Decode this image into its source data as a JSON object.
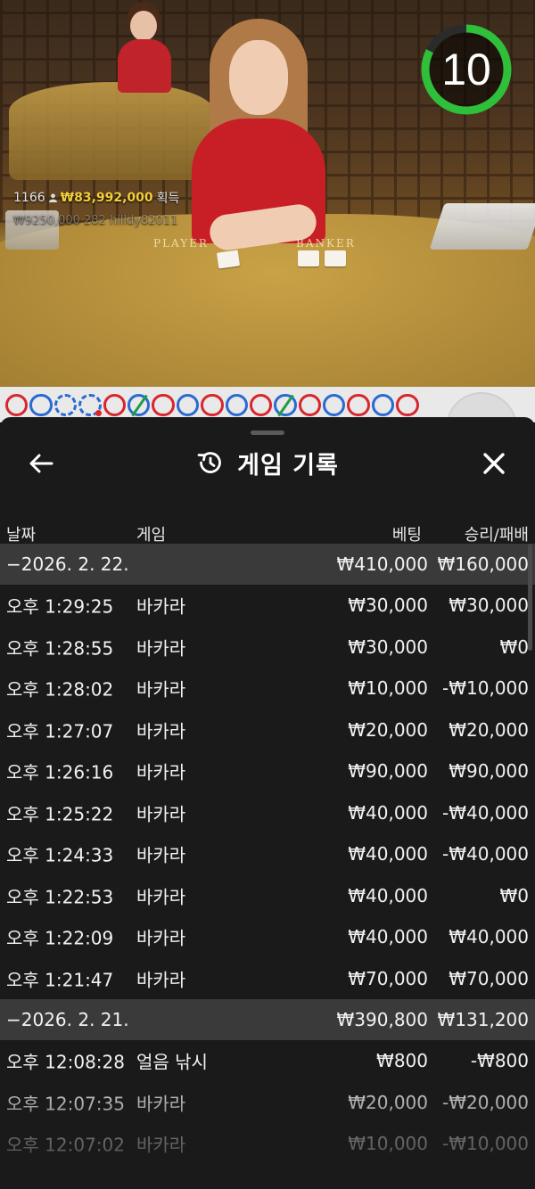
{
  "video": {
    "round_count": "1166",
    "win_amount": "₩83,992,000",
    "win_label": "획득",
    "ticker_text": "₩9250,000 282 hilldy82011",
    "table_player": "PLAYER",
    "table_banker": "BANKER",
    "countdown": "10"
  },
  "road": {
    "cells": [
      {
        "color": "red"
      },
      {
        "color": "blue"
      },
      {
        "color": "blue",
        "style": "dash"
      },
      {
        "color": "blue",
        "style": "dash",
        "dot": "red"
      },
      {
        "color": "red"
      },
      {
        "color": "blue",
        "slash": true
      },
      {
        "color": "red"
      },
      {
        "color": "blue"
      },
      {
        "color": "red"
      },
      {
        "color": "blue"
      },
      {
        "color": "red"
      },
      {
        "color": "blue",
        "slash": true
      },
      {
        "color": "red"
      },
      {
        "color": "blue"
      },
      {
        "color": "red"
      },
      {
        "color": "blue"
      },
      {
        "color": "red"
      }
    ],
    "colors": {
      "red": "#d8262e",
      "blue": "#2a6ad3",
      "tie": "#1f9c44"
    }
  },
  "panel": {
    "title": "게임 기록",
    "back_icon": "arrow-left-icon",
    "history_icon": "history-clock-icon",
    "close_icon": "close-icon",
    "columns": {
      "date": "날짜",
      "game": "게임",
      "bet": "베팅",
      "result": "승리/패배"
    },
    "groups": [
      {
        "date": "−2026. 2. 22.",
        "total_bet": "₩410,000",
        "total_result": "₩160,000",
        "rows": [
          {
            "time": "오후 1:29:25",
            "game": "바카라",
            "bet": "₩30,000",
            "result": "₩30,000"
          },
          {
            "time": "오후 1:28:55",
            "game": "바카라",
            "bet": "₩30,000",
            "result": "₩0"
          },
          {
            "time": "오후 1:28:02",
            "game": "바카라",
            "bet": "₩10,000",
            "result": "-₩10,000"
          },
          {
            "time": "오후 1:27:07",
            "game": "바카라",
            "bet": "₩20,000",
            "result": "₩20,000"
          },
          {
            "time": "오후 1:26:16",
            "game": "바카라",
            "bet": "₩90,000",
            "result": "₩90,000"
          },
          {
            "time": "오후 1:25:22",
            "game": "바카라",
            "bet": "₩40,000",
            "result": "-₩40,000"
          },
          {
            "time": "오후 1:24:33",
            "game": "바카라",
            "bet": "₩40,000",
            "result": "-₩40,000"
          },
          {
            "time": "오후 1:22:53",
            "game": "바카라",
            "bet": "₩40,000",
            "result": "₩0"
          },
          {
            "time": "오후 1:22:09",
            "game": "바카라",
            "bet": "₩40,000",
            "result": "₩40,000"
          },
          {
            "time": "오후 1:21:47",
            "game": "바카라",
            "bet": "₩70,000",
            "result": "₩70,000"
          }
        ]
      },
      {
        "date": "−2026. 2. 21.",
        "total_bet": "₩390,800",
        "total_result": "₩131,200",
        "rows": [
          {
            "time": "오후 12:08:28",
            "game": "얼음 낚시",
            "bet": "₩800",
            "result": "-₩800"
          },
          {
            "time": "오후 12:07:35",
            "game": "바카라",
            "bet": "₩20,000",
            "result": "-₩20,000"
          },
          {
            "time": "오후 12:07:02",
            "game": "바카라",
            "bet": "₩10,000",
            "result": "-₩10,000"
          }
        ]
      }
    ]
  }
}
